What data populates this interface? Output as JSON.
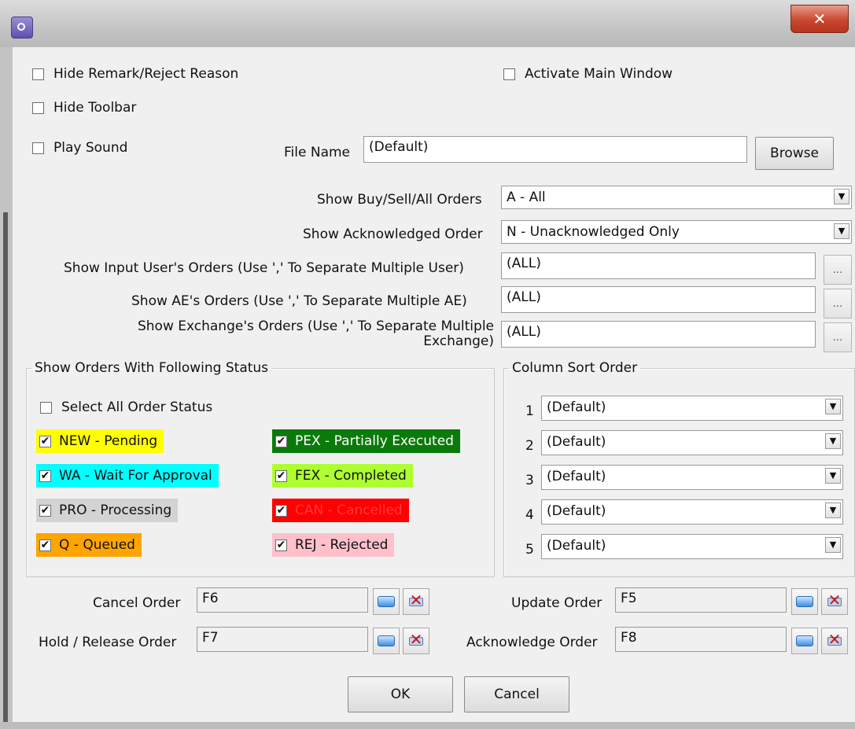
{
  "window": {
    "close_glyph": "✕"
  },
  "options": {
    "hide_remark": {
      "label": "Hide Remark/Reject Reason",
      "checked": false
    },
    "activate_main": {
      "label": "Activate Main Window",
      "checked": false
    },
    "hide_toolbar": {
      "label": "Hide Toolbar",
      "checked": false
    },
    "play_sound": {
      "label": "Play Sound",
      "checked": false
    }
  },
  "sound": {
    "file_label": "File Name",
    "file_value": "(Default)",
    "browse_label": "Browse"
  },
  "filters": {
    "buy_sell": {
      "label": "Show Buy/Sell/All Orders",
      "value": "A - All"
    },
    "ack": {
      "label": "Show Acknowledged Order",
      "value": "N - Unacknowledged Only"
    },
    "input_user": {
      "label": "Show Input User's Orders (Use ',' To Separate Multiple User)",
      "value": "(ALL)"
    },
    "ae": {
      "label": "Show AE's Orders (Use ',' To Separate Multiple AE)",
      "value": "(ALL)"
    },
    "exchange": {
      "label_line1": "Show Exchange's Orders (Use ',' To Separate Multiple",
      "label_line2": "Exchange)",
      "value": "(ALL)"
    },
    "ellipsis": "..."
  },
  "status_group": {
    "title": "Show Orders With Following Status",
    "select_all": {
      "label": "Select All Order Status",
      "checked": false
    },
    "items": [
      {
        "label": "NEW - Pending",
        "checked": true,
        "bg": "#ffff00",
        "fg": "#111111"
      },
      {
        "label": "PEX - Partially Executed",
        "checked": true,
        "bg": "#0a7a0a",
        "fg": "#ffffff"
      },
      {
        "label": "WA - Wait For Approval",
        "checked": true,
        "bg": "#00ffff",
        "fg": "#111111"
      },
      {
        "label": "FEX - Completed",
        "checked": true,
        "bg": "#adff2f",
        "fg": "#111111"
      },
      {
        "label": "PRO - Processing",
        "checked": true,
        "bg": "#d3d3d3",
        "fg": "#111111"
      },
      {
        "label": "CAN - Cancelled",
        "checked": true,
        "bg": "#ff0000",
        "fg": "#ff3a3a"
      },
      {
        "label": "Q - Queued",
        "checked": true,
        "bg": "#ffa500",
        "fg": "#111111"
      },
      {
        "label": "REJ - Rejected",
        "checked": true,
        "bg": "#ffc0cb",
        "fg": "#111111"
      }
    ]
  },
  "sort_group": {
    "title": "Column Sort Order",
    "rows": [
      {
        "index": "1",
        "value": "(Default)"
      },
      {
        "index": "2",
        "value": "(Default)"
      },
      {
        "index": "3",
        "value": "(Default)"
      },
      {
        "index": "4",
        "value": "(Default)"
      },
      {
        "index": "5",
        "value": "(Default)"
      }
    ]
  },
  "hotkeys": {
    "cancel": {
      "label": "Cancel Order",
      "value": "F6"
    },
    "update": {
      "label": "Update Order",
      "value": "F5"
    },
    "hold": {
      "label": "Hold / Release Order",
      "value": "F7"
    },
    "acknowledge": {
      "label": "Acknowledge Order",
      "value": "F8"
    }
  },
  "buttons": {
    "ok": "OK",
    "cancel": "Cancel"
  }
}
